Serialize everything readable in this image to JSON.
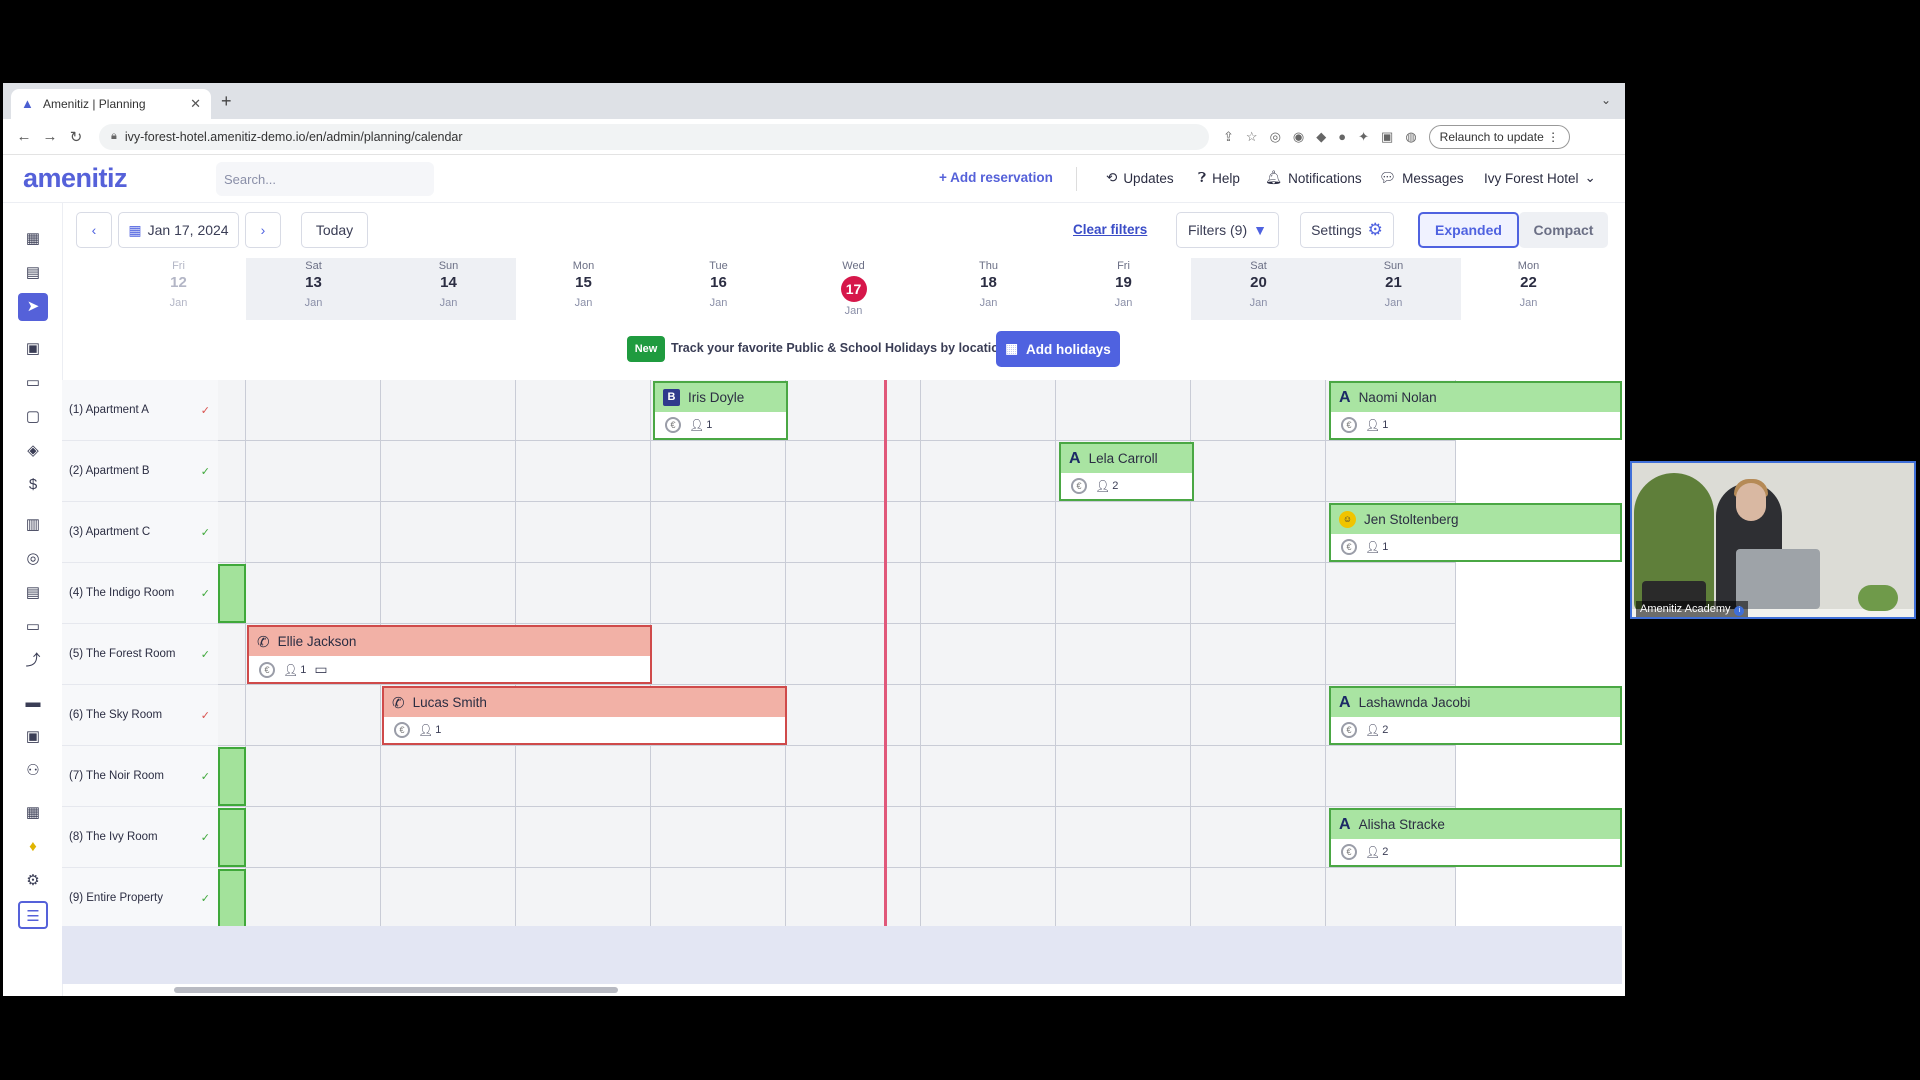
{
  "browser": {
    "tab_title": "Amenitiz | Planning",
    "url": "ivy-forest-hotel.amenitiz-demo.io/en/admin/planning/calendar",
    "relaunch_label": "Relaunch to update"
  },
  "header": {
    "logo": "amenitiz",
    "search_placeholder": "Search...",
    "add_reservation": "+ Add reservation",
    "updates": "Updates",
    "help": "Help",
    "notifications": "Notifications",
    "messages": "Messages",
    "hotel": "Ivy Forest Hotel"
  },
  "toolbar": {
    "date": "Jan 17, 2024",
    "today": "Today",
    "clear_filters": "Clear filters",
    "filters": "Filters (9)",
    "settings": "Settings",
    "expanded": "Expanded",
    "compact": "Compact"
  },
  "days": [
    {
      "dow": "Fri",
      "num": "12",
      "mon": "Jan"
    },
    {
      "dow": "Sat",
      "num": "13",
      "mon": "Jan"
    },
    {
      "dow": "Sun",
      "num": "14",
      "mon": "Jan"
    },
    {
      "dow": "Mon",
      "num": "15",
      "mon": "Jan"
    },
    {
      "dow": "Tue",
      "num": "16",
      "mon": "Jan"
    },
    {
      "dow": "Wed",
      "num": "17",
      "mon": "Jan"
    },
    {
      "dow": "Thu",
      "num": "18",
      "mon": "Jan"
    },
    {
      "dow": "Fri",
      "num": "19",
      "mon": "Jan"
    },
    {
      "dow": "Sat",
      "num": "20",
      "mon": "Jan"
    },
    {
      "dow": "Sun",
      "num": "21",
      "mon": "Jan"
    },
    {
      "dow": "Mon",
      "num": "22",
      "mon": "Jan"
    }
  ],
  "banner": {
    "tag": "New",
    "text": "Track your favorite Public & School Holidays by location.",
    "button": "Add holidays"
  },
  "rooms": [
    "(1) Apartment A",
    "(2) Apartment B",
    "(3) Apartment C",
    "(4) The Indigo Room",
    "(5) The Forest Room",
    "(6) The Sky Room",
    "(7) The Noir Room",
    "(8) The Ivy Room",
    "(9) Entire Property"
  ],
  "bookings": [
    {
      "guest": "Iris Doyle",
      "source": "B",
      "guests": "1"
    },
    {
      "guest": "Naomi Nolan",
      "source": "A",
      "guests": "1"
    },
    {
      "guest": "Lela Carroll",
      "source": "A",
      "guests": "2"
    },
    {
      "guest": "Jen Stoltenberg",
      "source": "Y",
      "guests": "1"
    },
    {
      "guest": "Ellie Jackson",
      "source": "phone",
      "guests": "1"
    },
    {
      "guest": "Lucas Smith",
      "source": "phone",
      "guests": "1"
    },
    {
      "guest": "Lashawnda Jacobi",
      "source": "A",
      "guests": "2"
    },
    {
      "guest": "Alisha Stracke",
      "source": "A",
      "guests": "2"
    }
  ],
  "video": {
    "label": "Amenitiz Academy"
  },
  "colors": {
    "accent": "#5561d9",
    "today": "#d6174a",
    "booking_green": "#a9e4a2",
    "booking_red": "#f2b1a6"
  }
}
